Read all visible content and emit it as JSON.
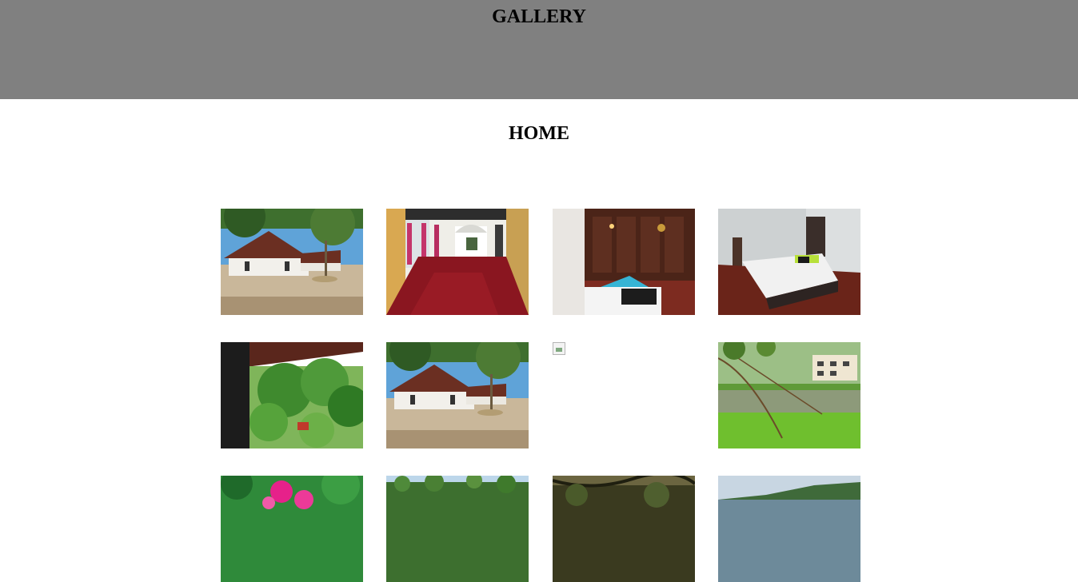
{
  "header": {
    "title": "GALLERY",
    "bg_color": "#808080"
  },
  "nav": {
    "home_label": "HOME"
  },
  "gallery": {
    "photos": [
      {
        "subject": "house-exterior"
      },
      {
        "subject": "hallway-red-floor"
      },
      {
        "subject": "bedroom-wood-wall"
      },
      {
        "subject": "bedroom-white-wall"
      },
      {
        "subject": "garden-veranda"
      },
      {
        "subject": "house-exterior"
      },
      {
        "subject": "broken-image"
      },
      {
        "subject": "pond-lawn-building"
      },
      {
        "subject": "pink-flowers"
      },
      {
        "subject": "palm-trees"
      },
      {
        "subject": "tree-canopy"
      },
      {
        "subject": "lake-view"
      }
    ]
  }
}
